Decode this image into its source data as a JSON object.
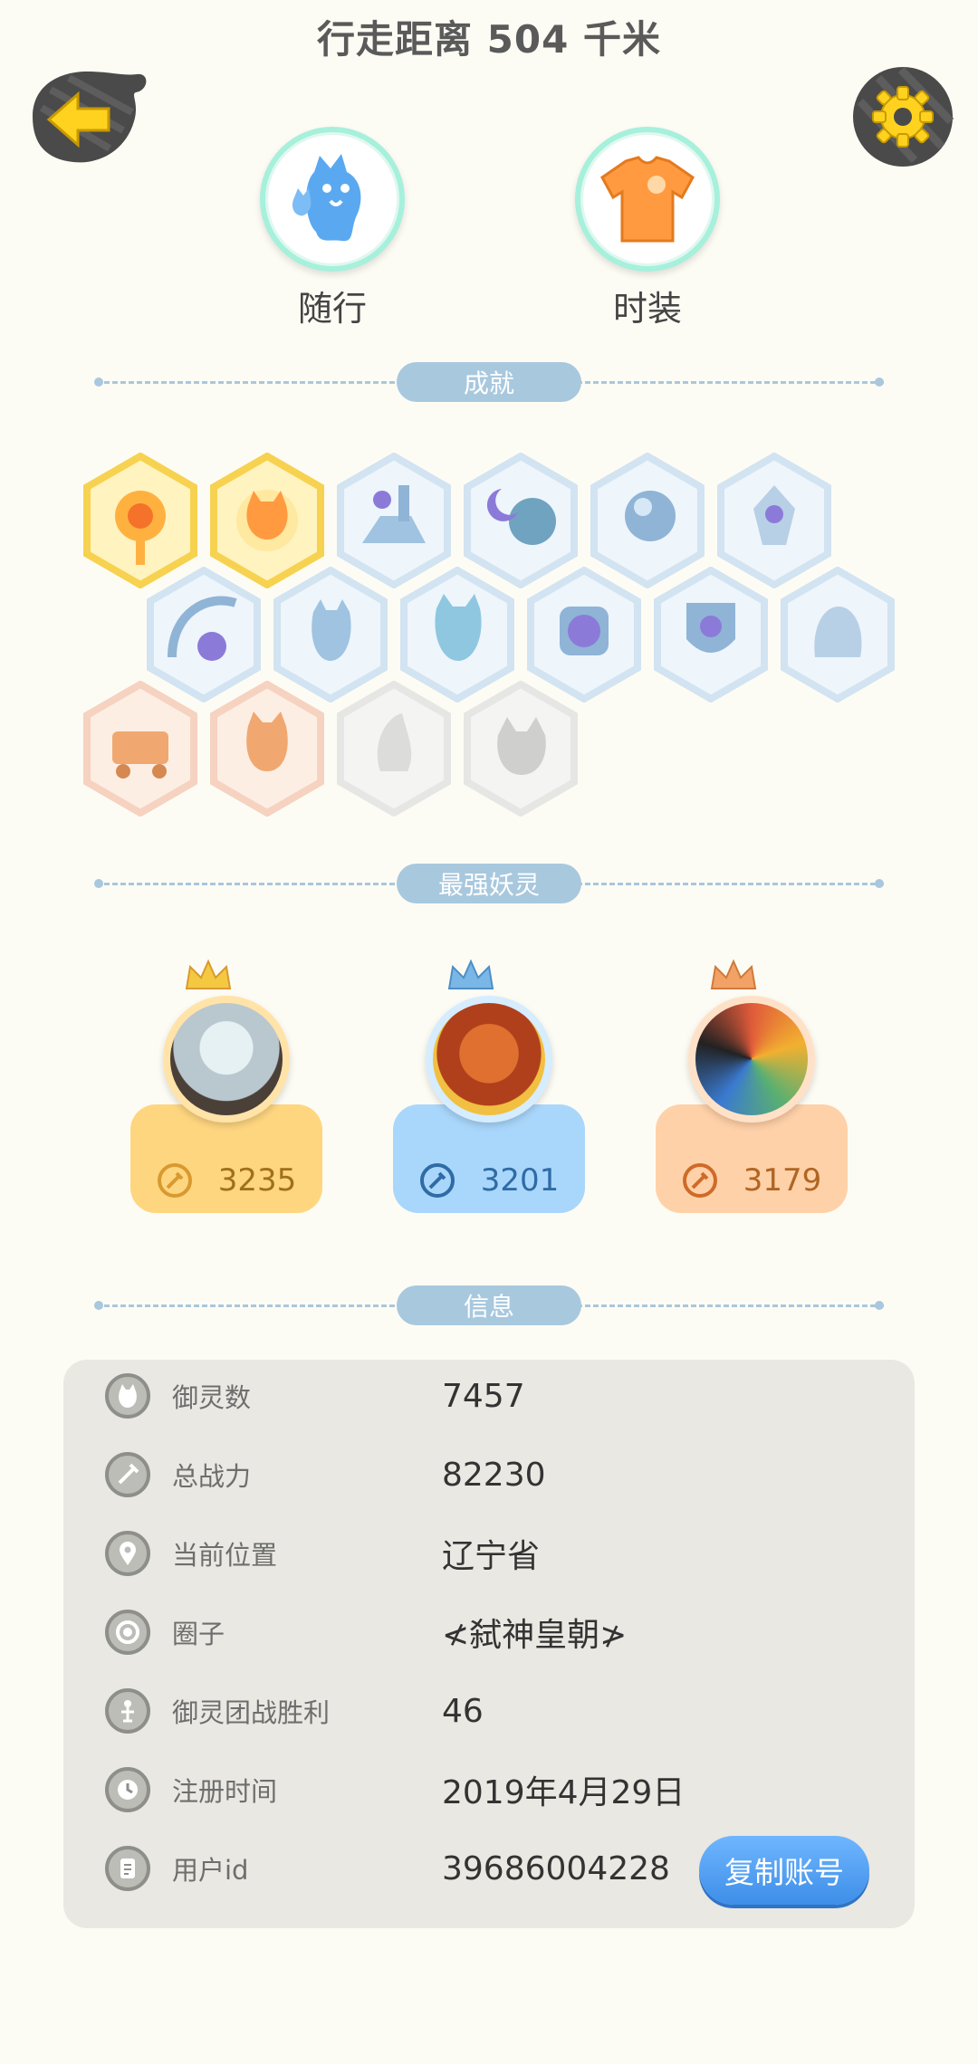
{
  "header": {
    "title": "行走距离 504 千米"
  },
  "top_buttons": {
    "follow_label": "随行",
    "fashion_label": "时装"
  },
  "sections": {
    "achievements": "成就",
    "strongest": "最强妖灵",
    "info": "信息"
  },
  "strongest_spirits": [
    {
      "power": "3235",
      "color": "#ffd680",
      "text_color": "#a0701c",
      "crown_color": "#f5c842"
    },
    {
      "power": "3201",
      "color": "#a9d7fb",
      "text_color": "#2f6ba5",
      "crown_color": "#7ab7e6"
    },
    {
      "power": "3179",
      "color": "#ffd1a8",
      "text_color": "#b06523",
      "crown_color": "#f2a267"
    }
  ],
  "info": {
    "rows": [
      {
        "icon": "spirit-icon",
        "label": "御灵数",
        "value": "7457"
      },
      {
        "icon": "sword-icon",
        "label": "总战力",
        "value": "82230"
      },
      {
        "icon": "location-icon",
        "label": "当前位置",
        "value": "辽宁省"
      },
      {
        "icon": "circle-icon",
        "label": "圈子",
        "value": "≮弑神皇朝≯"
      },
      {
        "icon": "trophy-icon",
        "label": "御灵团战胜利",
        "value": "46"
      },
      {
        "icon": "clock-icon",
        "label": "注册时间",
        "value": "2019年4月29日"
      },
      {
        "icon": "id-icon",
        "label": "用户id",
        "value": "39686004228"
      }
    ],
    "copy_button": "复制账号"
  },
  "colors": {
    "background": "#fdfcf4",
    "accent_blue": "#4a9af0",
    "pill": "#a8c8de"
  }
}
